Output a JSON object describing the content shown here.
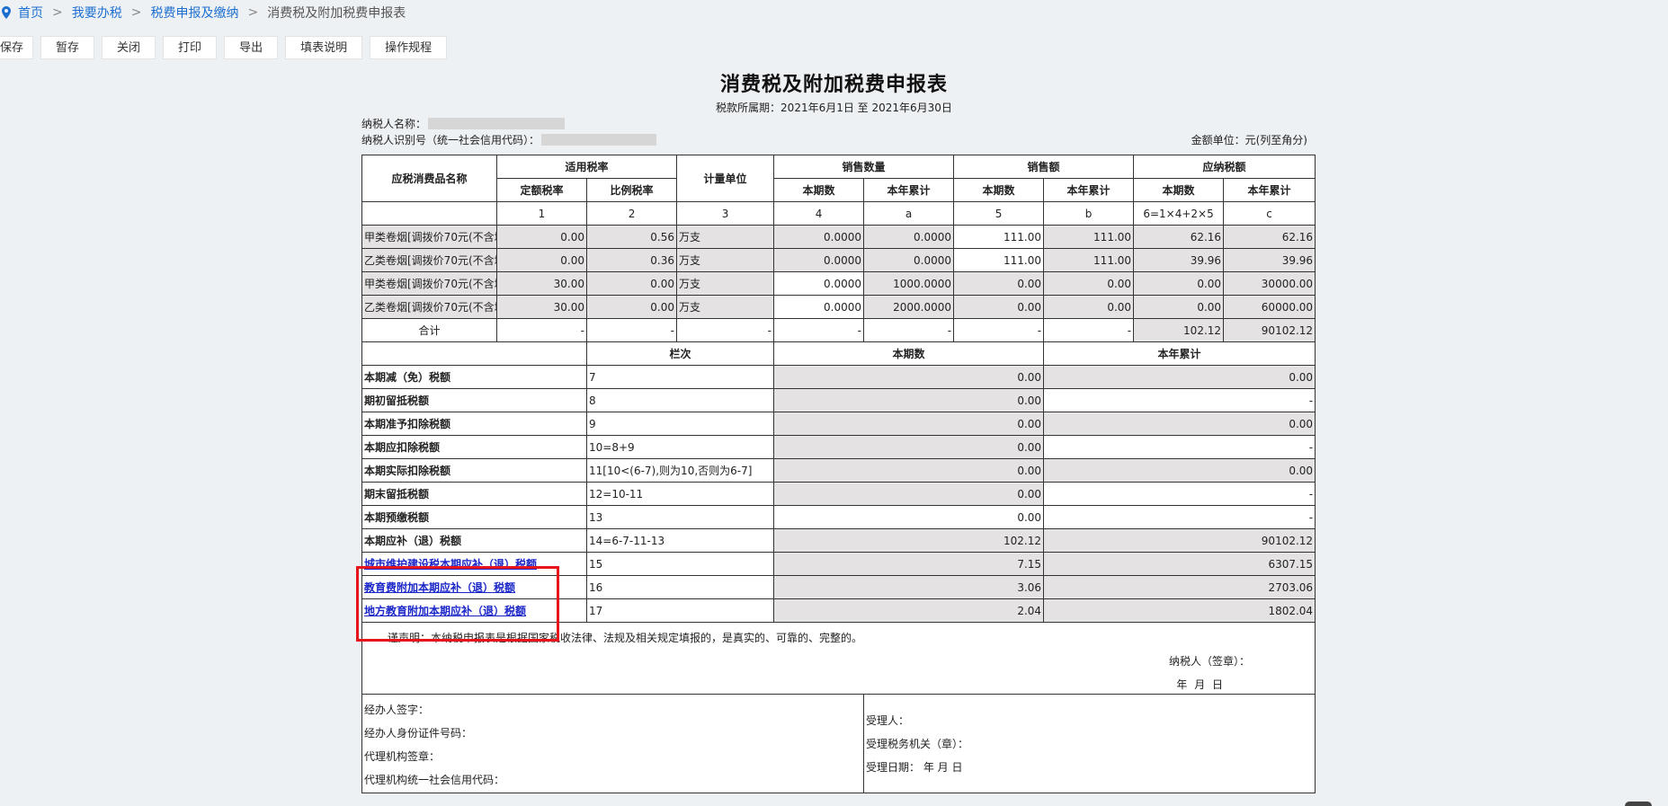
{
  "breadcrumb": {
    "home": "首页",
    "level1": "我要办税",
    "level2": "税费申报及缴纳",
    "current": "消费税及附加税费申报表",
    "separator": ">"
  },
  "toolbar": {
    "save": "保存",
    "draft": "暂存",
    "close": "关闭",
    "print": "打印",
    "export": "导出",
    "instructions": "填表说明",
    "procedures": "操作规程"
  },
  "header": {
    "title": "消费税及附加税费申报表",
    "period": "税款所属期：2021年6月1日 至 2021年6月30日",
    "taxpayer_name_label": "纳税人名称：",
    "taxpayer_id_label": "纳税人识别号（统一社会信用代码）：",
    "unit": "金额单位：元(列至角分)"
  },
  "table": {
    "head": {
      "product_name": "应税消费品名称",
      "rate_group": "适用税率",
      "fixed_rate": "定额税率",
      "prop_rate": "比例税率",
      "unit": "计量单位",
      "qty_group": "销售数量",
      "amt_group": "销售额",
      "tax_group": "应纳税额",
      "current": "本期数",
      "ytd": "本年累计"
    },
    "col_codes": [
      "1",
      "2",
      "3",
      "4",
      "a",
      "5",
      "b",
      "6=1×4+2×5",
      "c"
    ],
    "rows": [
      {
        "name": "甲类卷烟[调拨价70元(不含增",
        "fixed": "0.00",
        "prop": "0.56",
        "unit": "万支",
        "qty": "0.0000",
        "qty_ytd": "0.0000",
        "amt": "111.00",
        "amt_ytd": "111.00",
        "tax": "62.16",
        "tax_ytd": "62.16"
      },
      {
        "name": "乙类卷烟[调拨价70元(不含增",
        "fixed": "0.00",
        "prop": "0.36",
        "unit": "万支",
        "qty": "0.0000",
        "qty_ytd": "0.0000",
        "amt": "111.00",
        "amt_ytd": "111.00",
        "tax": "39.96",
        "tax_ytd": "39.96"
      },
      {
        "name": "甲类卷烟[调拨价70元(不含增",
        "fixed": "30.00",
        "prop": "0.00",
        "unit": "万支",
        "qty": "0.0000",
        "qty_ytd": "1000.0000",
        "amt": "0.00",
        "amt_ytd": "0.00",
        "tax": "0.00",
        "tax_ytd": "30000.00"
      },
      {
        "name": "乙类卷烟[调拨价70元(不含增",
        "fixed": "30.00",
        "prop": "0.00",
        "unit": "万支",
        "qty": "0.0000",
        "qty_ytd": "2000.0000",
        "amt": "0.00",
        "amt_ytd": "0.00",
        "tax": "0.00",
        "tax_ytd": "60000.00"
      }
    ],
    "total": {
      "label": "合计",
      "dash": "-",
      "tax": "102.12",
      "tax_ytd": "90102.12"
    },
    "section2_head": {
      "col": "栏次",
      "current": "本期数",
      "ytd": "本年累计"
    },
    "items": [
      {
        "label": "本期减（免）税额",
        "code": "7",
        "current": "0.00",
        "ytd": "0.00"
      },
      {
        "label": "期初留抵税额",
        "code": "8",
        "current": "0.00",
        "ytd": "-"
      },
      {
        "label": "本期准予扣除税额",
        "code": "9",
        "current": "0.00",
        "ytd": "0.00"
      },
      {
        "label": "本期应扣除税额",
        "code": "10=8+9",
        "current": "0.00",
        "ytd": "-"
      },
      {
        "label": "本期实际扣除税额",
        "code": "11[10<(6-7),则为10,否则为6-7]",
        "current": "0.00",
        "ytd": "0.00"
      },
      {
        "label": "期末留抵税额",
        "code": "12=10-11",
        "current": "0.00",
        "ytd": "-"
      },
      {
        "label": "本期预缴税额",
        "code": "13",
        "current": "0.00",
        "ytd": "-"
      },
      {
        "label": "本期应补（退）税额",
        "code": "14=6-7-11-13",
        "current": "102.12",
        "ytd": "90102.12"
      },
      {
        "label": "城市维护建设税本期应补（退）税额",
        "code": "15",
        "current": "7.15",
        "ytd": "6307.15"
      },
      {
        "label": "教育费附加本期应补（退）税额",
        "code": "16",
        "current": "3.06",
        "ytd": "2703.06"
      },
      {
        "label": "地方教育附加本期应补（退）税额",
        "code": "17",
        "current": "2.04",
        "ytd": "1802.04"
      }
    ],
    "declaration": "谨声明：本纳税申报表是根据国家税收法律、法规及相关规定填报的，是真实的、可靠的、完整的。",
    "taxpayer_sign": "纳税人（签章）：",
    "date_placeholder": "年 月 日",
    "agent": {
      "signer": "经办人签字：",
      "id_no": "经办人身份证件号码：",
      "agency_seal": "代理机构签章：",
      "agency_code": "代理机构统一社会信用代码："
    },
    "receiver": {
      "person": "受理人：",
      "office": "受理税务机关（章）：",
      "date": "受理日期：   年  月  日"
    }
  },
  "colors": {
    "link": "#1c6fd1",
    "highlight": "#e8141b",
    "readonly_cell": "#e4e2e2"
  }
}
